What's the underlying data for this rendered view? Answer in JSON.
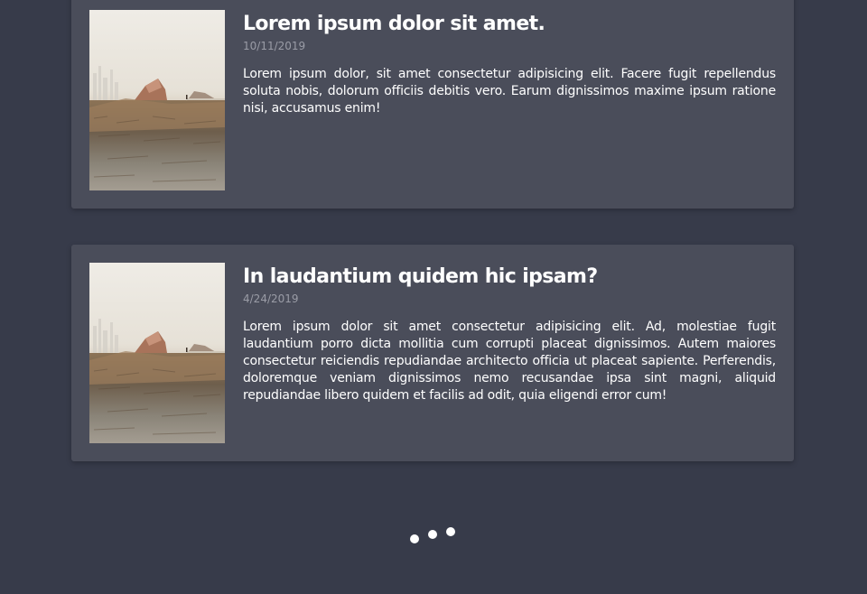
{
  "posts": [
    {
      "title": "Lorem ipsum dolor sit amet.",
      "date": "10/11/2019",
      "excerpt": "Lorem ipsum dolor, sit amet consectetur adipisicing elit. Facere fugit repellendus soluta nobis, dolorum officiis debitis vero. Earum dignissimos maxime ipsum ratione nisi, accusamus enim!",
      "thumbnail": "beach-landscape-image"
    },
    {
      "title": "In laudantium quidem hic ipsam?",
      "date": "4/24/2019",
      "excerpt": "Lorem ipsum dolor sit amet consectetur adipisicing elit. Ad, molestiae fugit laudantium porro dicta mollitia cum corrupti placeat dignissimos. Autem maiores consectetur reiciendis repudiandae architecto officia ut placeat sapiente. Perferendis, doloremque veniam dignissimos nemo recusandae ipsa sint magni, aliquid repudiandae libero quidem et facilis ad odit, quia eligendi error cum!",
      "thumbnail": "beach-landscape-image"
    }
  ],
  "loader": {
    "icon": "loading-dots-icon",
    "dot_count": 3
  },
  "colors": {
    "background": "#373b4a",
    "card": "#4a4d5a",
    "title": "#ffffff",
    "date": "#9a9ca6",
    "text": "#ffffff"
  }
}
